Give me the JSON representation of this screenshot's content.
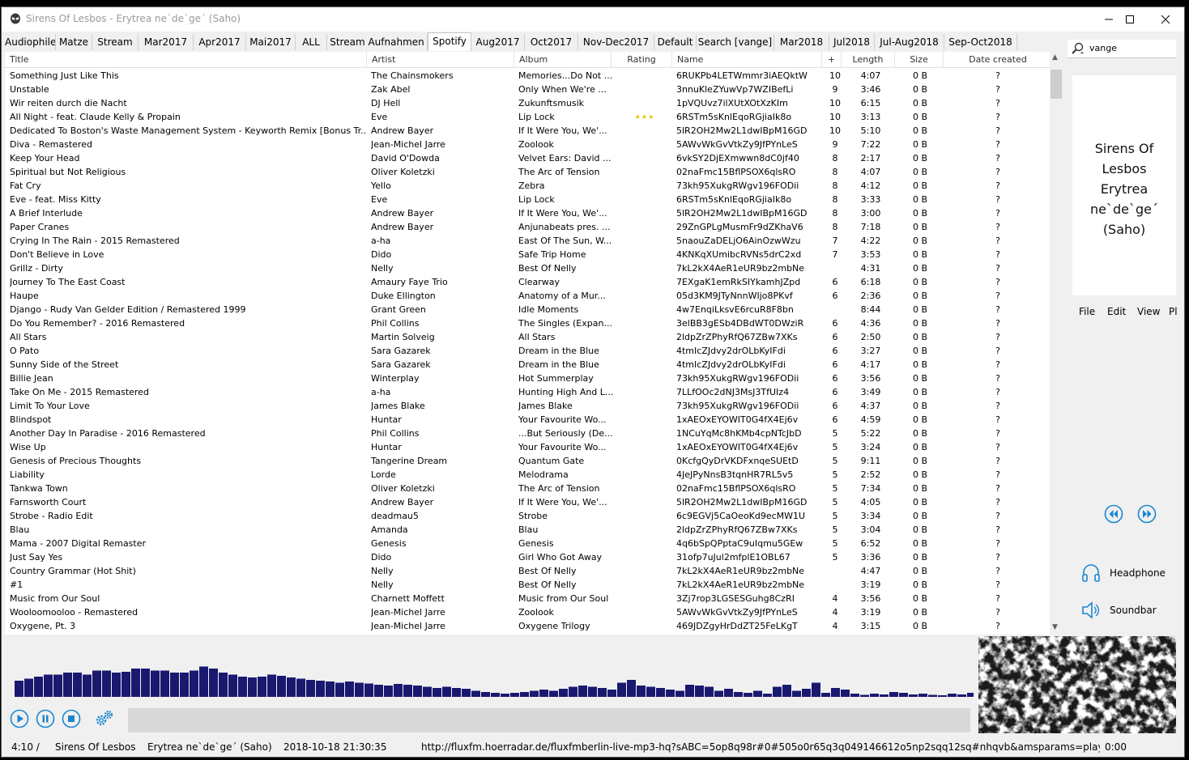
{
  "window": {
    "title": "Sirens Of Lesbos - Erytrea ne`de`ge´ (Saho)"
  },
  "tabs": [
    "Audiophile",
    "Matze",
    "Stream",
    "Mar2017",
    "Apr2017",
    "Mai2017",
    "ALL",
    "Stream Aufnahmen",
    "Spotify",
    "Aug2017",
    "Oct2017",
    "Nov-Dec2017",
    "Default",
    "Search [vange]",
    "Mar2018",
    "Jul2018",
    "Jul-Aug2018",
    "Sep-Oct2018"
  ],
  "active_tab": "Spotify",
  "search": {
    "value": "vange"
  },
  "columns": [
    "Title",
    "Artist",
    "Album",
    "Rating",
    "Name",
    "+",
    "Length",
    "Size",
    "Date created"
  ],
  "tracks": [
    {
      "title": "Something Just Like This",
      "artist": "The Chainsmokers",
      "album": "Memories...Do Not ...",
      "rating": "",
      "name": "6RUKPb4LETWmmr3iAEQktW",
      "plus": "10",
      "length": "4:07",
      "size": "0 B",
      "date": "?"
    },
    {
      "title": "Unstable",
      "artist": "Zak Abel",
      "album": "Only When We're ...",
      "rating": "",
      "name": "3nnuKleZYuwVp7WZIBefLi",
      "plus": "9",
      "length": "3:46",
      "size": "0 B",
      "date": "?"
    },
    {
      "title": "Wir reiten durch die Nacht",
      "artist": "DJ Hell",
      "album": "Zukunftsmusik",
      "rating": "",
      "name": "1pVQUvz7ilXUtXOtXzKIm",
      "plus": "10",
      "length": "6:15",
      "size": "0 B",
      "date": "?"
    },
    {
      "title": "All Night - feat. Claude Kelly & Propain",
      "artist": "Eve",
      "album": "Lip Lock",
      "rating": "★★★",
      "name": "6RSTm5sKnlEqoRGjiaIk8o",
      "plus": "10",
      "length": "3:13",
      "size": "0 B",
      "date": "?"
    },
    {
      "title": "Dedicated To Boston's Waste Management System - Keyworth Remix [Bonus Tr...",
      "artist": "Andrew Bayer",
      "album": "If It Were You, We'...",
      "rating": "",
      "name": "5lR2OH2Mw2L1dwIBpM16GD",
      "plus": "10",
      "length": "5:10",
      "size": "0 B",
      "date": "?"
    },
    {
      "title": "Diva - Remastered",
      "artist": "Jean-Michel Jarre",
      "album": "Zoolook",
      "rating": "",
      "name": "5AWvWkGvVtkZy9JfPYnLeS",
      "plus": "9",
      "length": "7:22",
      "size": "0 B",
      "date": "?"
    },
    {
      "title": "Keep Your Head",
      "artist": "David O'Dowda",
      "album": "Velvet Ears: David ...",
      "rating": "",
      "name": "6vkSY2DjEXmwwn8dC0jf40",
      "plus": "8",
      "length": "2:17",
      "size": "0 B",
      "date": "?"
    },
    {
      "title": "Spiritual but Not Religious",
      "artist": "Oliver Koletzki",
      "album": "The Arc of Tension",
      "rating": "",
      "name": "02naFmc15BflPSOX6qlsRO",
      "plus": "8",
      "length": "4:07",
      "size": "0 B",
      "date": "?"
    },
    {
      "title": "Fat Cry",
      "artist": "Yello",
      "album": "Zebra",
      "rating": "",
      "name": "73kh95XukgRWgv196FODii",
      "plus": "8",
      "length": "4:12",
      "size": "0 B",
      "date": "?"
    },
    {
      "title": "Eve - feat. Miss Kitty",
      "artist": "Eve",
      "album": "Lip Lock",
      "rating": "",
      "name": "6RSTm5sKnlEqoRGjiaIk8o",
      "plus": "8",
      "length": "3:33",
      "size": "0 B",
      "date": "?"
    },
    {
      "title": "A Brief Interlude",
      "artist": "Andrew Bayer",
      "album": "If It Were You, We'...",
      "rating": "",
      "name": "5lR2OH2Mw2L1dwIBpM16GD",
      "plus": "8",
      "length": "3:00",
      "size": "0 B",
      "date": "?"
    },
    {
      "title": "Paper Cranes",
      "artist": "Andrew Bayer",
      "album": "Anjunabeats pres. ...",
      "rating": "",
      "name": "29ZnGPLgMusmFr9dZKhaV6",
      "plus": "8",
      "length": "7:18",
      "size": "0 B",
      "date": "?"
    },
    {
      "title": "Crying In The Rain - 2015 Remastered",
      "artist": "a-ha",
      "album": "East Of The Sun, W...",
      "rating": "",
      "name": "5naouZaDELjO6AinOzwWzu",
      "plus": "7",
      "length": "4:22",
      "size": "0 B",
      "date": "?"
    },
    {
      "title": "Don't Believe in Love",
      "artist": "Dido",
      "album": "Safe Trip Home",
      "rating": "",
      "name": "4KNKqXUmibcRVNs5drC2xd",
      "plus": "7",
      "length": "3:53",
      "size": "0 B",
      "date": "?"
    },
    {
      "title": "Grillz - Dirty",
      "artist": "Nelly",
      "album": "Best Of Nelly",
      "rating": "",
      "name": "7kL2kX4AeR1eUR9bz2mbNe",
      "plus": "",
      "length": "4:31",
      "size": "0 B",
      "date": "?"
    },
    {
      "title": "Journey To The East Coast",
      "artist": "Amaury Faye Trio",
      "album": "Clearway",
      "rating": "",
      "name": "7EXgaK1emRkSIYkamhJZpd",
      "plus": "6",
      "length": "6:18",
      "size": "0 B",
      "date": "?"
    },
    {
      "title": "Haupe",
      "artist": "Duke Ellington",
      "album": "Anatomy of a Mur...",
      "rating": "",
      "name": "05d3KM9JTyNnnWIjo8PKvf",
      "plus": "6",
      "length": "2:36",
      "size": "0 B",
      "date": "?"
    },
    {
      "title": "Django - Rudy Van Gelder Edition / Remastered 1999",
      "artist": "Grant Green",
      "album": "Idle Moments",
      "rating": "",
      "name": "4w7EnqiLksvE6rcuR8F8bn",
      "plus": "",
      "length": "8:44",
      "size": "0 B",
      "date": "?"
    },
    {
      "title": "Do You Remember? - 2016 Remastered",
      "artist": "Phil Collins",
      "album": "The Singles (Expan...",
      "rating": "",
      "name": "3elBB3gESb4DBdWT0DWziR",
      "plus": "6",
      "length": "4:36",
      "size": "0 B",
      "date": "?"
    },
    {
      "title": "All Stars",
      "artist": "Martin Solveig",
      "album": "All Stars",
      "rating": "",
      "name": "2ldpZrZPhyRfQ67ZBw7XKs",
      "plus": "6",
      "length": "2:50",
      "size": "0 B",
      "date": "?"
    },
    {
      "title": "O Pato",
      "artist": "Sara Gazarek",
      "album": "Dream in the Blue",
      "rating": "",
      "name": "4tmIcZJdvy2drOLbKyIFdi",
      "plus": "6",
      "length": "3:27",
      "size": "0 B",
      "date": "?"
    },
    {
      "title": "Sunny Side of the Street",
      "artist": "Sara Gazarek",
      "album": "Dream in the Blue",
      "rating": "",
      "name": "4tmIcZJdvy2drOLbKyIFdi",
      "plus": "6",
      "length": "4:17",
      "size": "0 B",
      "date": "?"
    },
    {
      "title": "Billie Jean",
      "artist": "Winterplay",
      "album": "Hot Summerplay",
      "rating": "",
      "name": "73kh95XukgRWgv196FODii",
      "plus": "6",
      "length": "3:56",
      "size": "0 B",
      "date": "?"
    },
    {
      "title": "Take On Me - 2015 Remastered",
      "artist": "a-ha",
      "album": "Hunting High And L...",
      "rating": "",
      "name": "7LLfOOc2dNJ3MsJ3TfUIz4",
      "plus": "6",
      "length": "3:49",
      "size": "0 B",
      "date": "?"
    },
    {
      "title": "Limit To Your Love",
      "artist": "James Blake",
      "album": "James Blake",
      "rating": "",
      "name": "73kh95XukgRWgv196FODii",
      "plus": "6",
      "length": "4:37",
      "size": "0 B",
      "date": "?"
    },
    {
      "title": "Blindspot",
      "artist": "Huntar",
      "album": "Your Favourite Wo...",
      "rating": "",
      "name": "1xAEOxEYOWIT0G4fX4Ej6v",
      "plus": "6",
      "length": "4:59",
      "size": "0 B",
      "date": "?"
    },
    {
      "title": "Another Day In Paradise - 2016 Remastered",
      "artist": "Phil Collins",
      "album": "...But Seriously (De...",
      "rating": "",
      "name": "1NCuYqMc8hKMb4cpNTcJbD",
      "plus": "5",
      "length": "5:22",
      "size": "0 B",
      "date": "?"
    },
    {
      "title": "Wise Up",
      "artist": "Huntar",
      "album": "Your Favourite Wo...",
      "rating": "",
      "name": "1xAEOxEYOWIT0G4fX4Ej6v",
      "plus": "5",
      "length": "3:24",
      "size": "0 B",
      "date": "?"
    },
    {
      "title": "Genesis of Precious Thoughts",
      "artist": "Tangerine Dream",
      "album": "Quantum Gate",
      "rating": "",
      "name": "0KcfgQyDrVKDFxnqeSUEtD",
      "plus": "5",
      "length": "9:11",
      "size": "0 B",
      "date": "?"
    },
    {
      "title": "Liability",
      "artist": "Lorde",
      "album": "Melodrama",
      "rating": "",
      "name": "4JeJPyNnsB3tqnHR7RL5v5",
      "plus": "5",
      "length": "2:52",
      "size": "0 B",
      "date": "?"
    },
    {
      "title": "Tankwa Town",
      "artist": "Oliver Koletzki",
      "album": "The Arc of Tension",
      "rating": "",
      "name": "02naFmc15BflPSOX6qlsRO",
      "plus": "5",
      "length": "7:34",
      "size": "0 B",
      "date": "?"
    },
    {
      "title": "Farnsworth Court",
      "artist": "Andrew Bayer",
      "album": "If It Were You, We'...",
      "rating": "",
      "name": "5lR2OH2Mw2L1dwIBpM16GD",
      "plus": "5",
      "length": "4:05",
      "size": "0 B",
      "date": "?"
    },
    {
      "title": "Strobe - Radio Edit",
      "artist": "deadmau5",
      "album": "Strobe",
      "rating": "",
      "name": "6c9EGVj5CaOeoKd9ecMW1U",
      "plus": "5",
      "length": "3:34",
      "size": "0 B",
      "date": "?"
    },
    {
      "title": "Blau",
      "artist": "Amanda",
      "album": "Blau",
      "rating": "",
      "name": "2ldpZrZPhyRfQ67ZBw7XKs",
      "plus": "5",
      "length": "3:04",
      "size": "0 B",
      "date": "?"
    },
    {
      "title": "Mama - 2007 Digital Remaster",
      "artist": "Genesis",
      "album": "Genesis",
      "rating": "",
      "name": "4q6bSpQPptaC9uIqmu5GEw",
      "plus": "5",
      "length": "6:52",
      "size": "0 B",
      "date": "?"
    },
    {
      "title": "Just Say Yes",
      "artist": "Dido",
      "album": "Girl Who Got Away",
      "rating": "",
      "name": "31ofp7uJul2mfplE1OBL67",
      "plus": "5",
      "length": "3:36",
      "size": "0 B",
      "date": "?"
    },
    {
      "title": "Country Grammar (Hot Shit)",
      "artist": "Nelly",
      "album": "Best Of Nelly",
      "rating": "",
      "name": "7kL2kX4AeR1eUR9bz2mbNe",
      "plus": "",
      "length": "4:47",
      "size": "0 B",
      "date": "?"
    },
    {
      "title": "#1",
      "artist": "Nelly",
      "album": "Best Of Nelly",
      "rating": "",
      "name": "7kL2kX4AeR1eUR9bz2mbNe",
      "plus": "",
      "length": "3:19",
      "size": "0 B",
      "date": "?"
    },
    {
      "title": "Music from Our Soul",
      "artist": "Charnett Moffett",
      "album": "Music from Our Soul",
      "rating": "",
      "name": "3Zj7rop3LGSESGuhg8CzRI",
      "plus": "4",
      "length": "3:56",
      "size": "0 B",
      "date": "?"
    },
    {
      "title": "Wooloomooloo - Remastered",
      "artist": "Jean-Michel Jarre",
      "album": "Zoolook",
      "rating": "",
      "name": "5AWvWkGvVtkZy9JfPYnLeS",
      "plus": "4",
      "length": "3:19",
      "size": "0 B",
      "date": "?"
    },
    {
      "title": "Oxygene, Pt. 3",
      "artist": "Jean-Michel Jarre",
      "album": "Oxygene Trilogy",
      "rating": "",
      "name": "469JDZgyHrDdZT25FeLKgT",
      "plus": "4",
      "length": "3:15",
      "size": "0 B",
      "date": "?"
    }
  ],
  "now_playing": {
    "cover_lines": [
      "Sirens Of",
      "Lesbos",
      "Erytrea",
      "ne`de`ge´",
      "(Saho)"
    ]
  },
  "side_menu": [
    "File",
    "Edit",
    "View",
    "Pl"
  ],
  "devices": [
    {
      "label": "Headphone",
      "icon": "headphone-icon"
    },
    {
      "label": "Soundbar",
      "icon": "speaker-icon"
    }
  ],
  "spectrum_levels": [
    0.4,
    0.45,
    0.5,
    0.55,
    0.55,
    0.6,
    0.6,
    0.55,
    0.65,
    0.65,
    0.6,
    0.62,
    0.7,
    0.7,
    0.65,
    0.65,
    0.6,
    0.6,
    0.65,
    0.75,
    0.7,
    0.6,
    0.55,
    0.5,
    0.48,
    0.5,
    0.55,
    0.52,
    0.48,
    0.45,
    0.42,
    0.4,
    0.38,
    0.35,
    0.38,
    0.35,
    0.33,
    0.3,
    0.28,
    0.32,
    0.3,
    0.28,
    0.25,
    0.22,
    0.25,
    0.22,
    0.2,
    0.15,
    0.12,
    0.1,
    0.08,
    0.1,
    0.12,
    0.15,
    0.18,
    0.15,
    0.2,
    0.25,
    0.28,
    0.25,
    0.22,
    0.18,
    0.35,
    0.42,
    0.28,
    0.25,
    0.22,
    0.18,
    0.15,
    0.3,
    0.28,
    0.25,
    0.15,
    0.2,
    0.12,
    0.1,
    0.15,
    0.08,
    0.25,
    0.3,
    0.15,
    0.2,
    0.35,
    0.1,
    0.22,
    0.18,
    0.08,
    0.05,
    0.08,
    0.06,
    0.12,
    0.1,
    0.06,
    0.08,
    0.05,
    0.04,
    0.08,
    0.06,
    0.1,
    0.08
  ],
  "colors": {
    "accent": "#1a86d0",
    "spectrum": "#191970"
  },
  "status": {
    "time": "4:10 /",
    "artist": "Sirens Of Lesbos",
    "song": "Erytrea ne`de`ge´ (Saho)",
    "datetime": "2018-10-18 21:30:35",
    "url": "http://fluxfm.hoerradar.de/fluxfmberlin-live-mp3-hq?sABC=5op8q98r#0#505o0r65q3q049146612o5np2sqq12sq#nhqvb&amsparams=playe",
    "elapsed": "0:00"
  }
}
